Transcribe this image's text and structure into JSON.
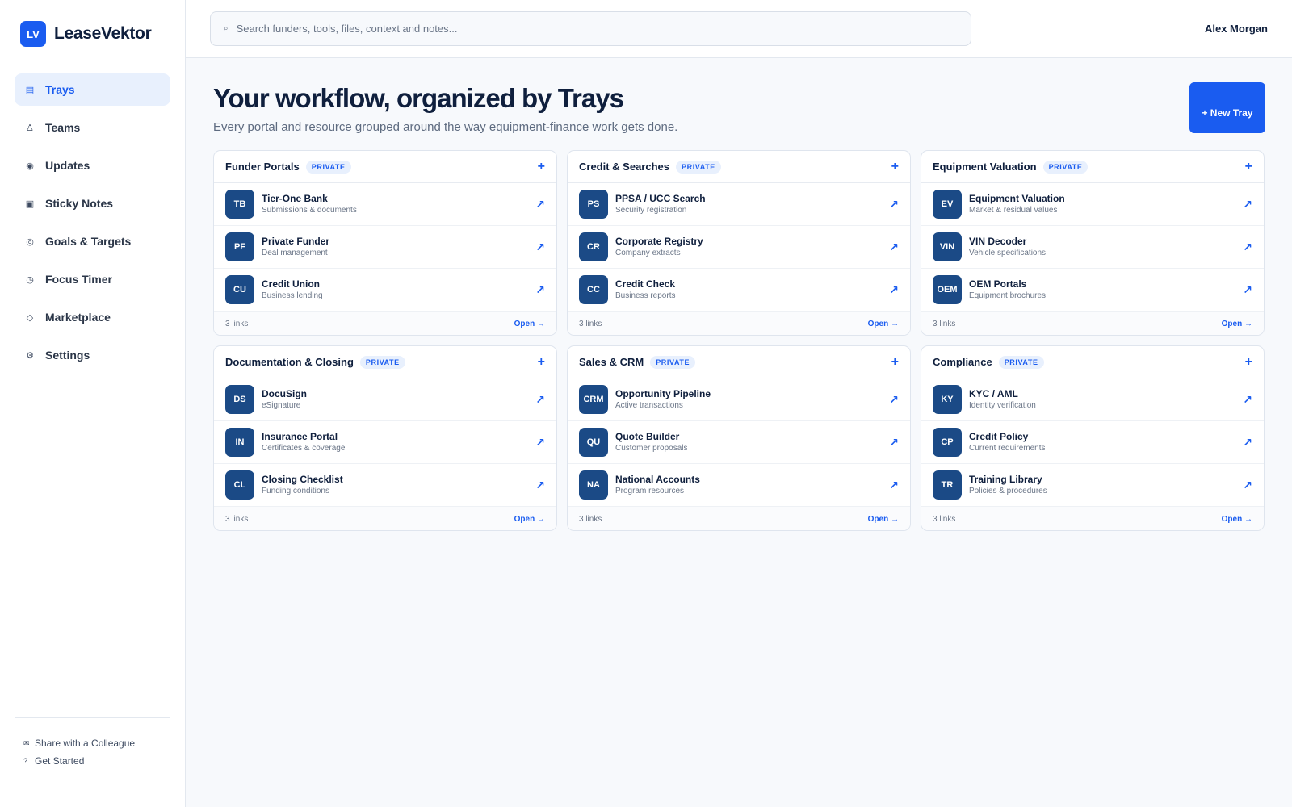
{
  "app": {
    "logo": "LV",
    "name": "LeaseVektor"
  },
  "sidebar": {
    "items": [
      {
        "label": "Trays",
        "icon": "▤",
        "icon_name": "trays-icon",
        "active": true
      },
      {
        "label": "Teams",
        "icon": "♙",
        "icon_name": "teams-icon",
        "active": false
      },
      {
        "label": "Updates",
        "icon": "◉",
        "icon_name": "updates-icon",
        "active": false
      },
      {
        "label": "Sticky Notes",
        "icon": "▣",
        "icon_name": "sticky-notes-icon",
        "active": false
      },
      {
        "label": "Goals & Targets",
        "icon": "◎",
        "icon_name": "goals-icon",
        "active": false
      },
      {
        "label": "Focus Timer",
        "icon": "◷",
        "icon_name": "timer-icon",
        "active": false
      },
      {
        "label": "Marketplace",
        "icon": "◇",
        "icon_name": "marketplace-icon",
        "active": false
      },
      {
        "label": "Settings",
        "icon": "⚙",
        "icon_name": "settings-icon",
        "active": false
      }
    ],
    "footer": {
      "share_icon": "✉",
      "share_label": "Share with a Colleague",
      "help_icon": "?",
      "help_label": "Get Started"
    }
  },
  "topbar": {
    "search_icon": "⌕",
    "search_placeholder": "Search funders, tools, files, context and notes...",
    "user_name": "Alex Morgan"
  },
  "main": {
    "title": "Your workflow, organized by Trays",
    "subtitle": "Every portal and resource grouped around the way equipment-finance work gets done.",
    "new_tray_label": "+ New Tray"
  },
  "trays": [
    {
      "title": "Funder Portals",
      "badge": "PRIVATE",
      "add": "+",
      "count": "3 links",
      "open": "Open →",
      "links": [
        {
          "initials": "TB",
          "name": "Tier-One Bank",
          "desc": "Submissions & documents"
        },
        {
          "initials": "PF",
          "name": "Private Funder",
          "desc": "Deal management"
        },
        {
          "initials": "CU",
          "name": "Credit Union",
          "desc": "Business lending"
        }
      ]
    },
    {
      "title": "Credit & Searches",
      "badge": "PRIVATE",
      "add": "+",
      "count": "3 links",
      "open": "Open →",
      "links": [
        {
          "initials": "PS",
          "name": "PPSA / UCC Search",
          "desc": "Security registration"
        },
        {
          "initials": "CR",
          "name": "Corporate Registry",
          "desc": "Company extracts"
        },
        {
          "initials": "CC",
          "name": "Credit Check",
          "desc": "Business reports"
        }
      ]
    },
    {
      "title": "Equipment Valuation",
      "badge": "PRIVATE",
      "add": "+",
      "count": "3 links",
      "open": "Open →",
      "links": [
        {
          "initials": "EV",
          "name": "Equipment Valuation",
          "desc": "Market & residual values"
        },
        {
          "initials": "VIN",
          "name": "VIN Decoder",
          "desc": "Vehicle specifications"
        },
        {
          "initials": "OEM",
          "name": "OEM Portals",
          "desc": "Equipment brochures"
        }
      ]
    },
    {
      "title": "Documentation & Closing",
      "badge": "PRIVATE",
      "add": "+",
      "count": "3 links",
      "open": "Open →",
      "links": [
        {
          "initials": "DS",
          "name": "DocuSign",
          "desc": "eSignature"
        },
        {
          "initials": "IN",
          "name": "Insurance Portal",
          "desc": "Certificates & coverage"
        },
        {
          "initials": "CL",
          "name": "Closing Checklist",
          "desc": "Funding conditions"
        }
      ]
    },
    {
      "title": "Sales & CRM",
      "badge": "PRIVATE",
      "add": "+",
      "count": "3 links",
      "open": "Open →",
      "links": [
        {
          "initials": "CRM",
          "name": "Opportunity Pipeline",
          "desc": "Active transactions"
        },
        {
          "initials": "QU",
          "name": "Quote Builder",
          "desc": "Customer proposals"
        },
        {
          "initials": "NA",
          "name": "National Accounts",
          "desc": "Program resources"
        }
      ]
    },
    {
      "title": "Compliance",
      "badge": "PRIVATE",
      "add": "+",
      "count": "3 links",
      "open": "Open →",
      "links": [
        {
          "initials": "KY",
          "name": "KYC / AML",
          "desc": "Identity verification"
        },
        {
          "initials": "CP",
          "name": "Credit Policy",
          "desc": "Current requirements"
        },
        {
          "initials": "TR",
          "name": "Training Library",
          "desc": "Policies & procedures"
        }
      ]
    }
  ],
  "link_arrow": "↗",
  "colors": {
    "accent": "#1a5cf0",
    "avatar": "#1b4a86",
    "active_bg": "#e8f0fd"
  }
}
